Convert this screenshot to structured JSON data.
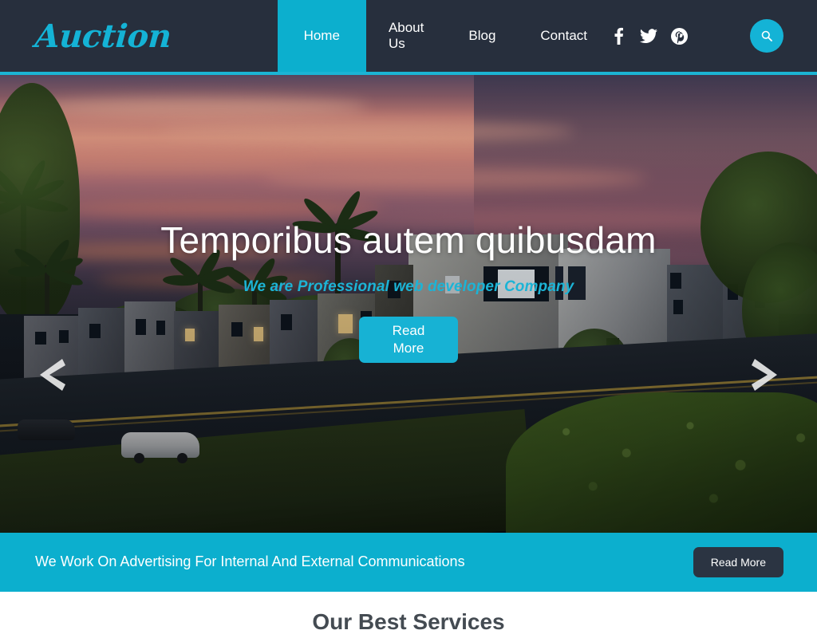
{
  "header": {
    "logo": "Auction",
    "nav": [
      {
        "label": "Home",
        "active": true
      },
      {
        "label": "About Us",
        "active": false
      },
      {
        "label": "Blog",
        "active": false
      },
      {
        "label": "Contact",
        "active": false
      }
    ],
    "socials": [
      {
        "name": "facebook-icon",
        "glyph": "f"
      },
      {
        "name": "twitter-icon",
        "glyph": "t"
      },
      {
        "name": "pinterest-icon",
        "glyph": "p"
      }
    ],
    "search_icon": "search-icon",
    "accent_color": "#0cafce",
    "bar_color": "#272f3d"
  },
  "hero": {
    "title": "Temporibus autem quibusdam",
    "subtitle": "We are Professional web developer Company",
    "button": "Read\nMore",
    "button_label": "Read More",
    "prev_icon": "chevron-left-icon",
    "next_icon": "chevron-right-icon",
    "title_color": "#ffffff",
    "subtitle_color": "#1cb4d6",
    "button_color": "#17b2d4"
  },
  "cta": {
    "text": "We Work On Advertising For Internal And External Communications",
    "button": "Read More",
    "background": "#0cafce",
    "button_background": "#2b3442"
  },
  "services": {
    "heading": "Our Best Services",
    "heading_color": "#444b52"
  }
}
